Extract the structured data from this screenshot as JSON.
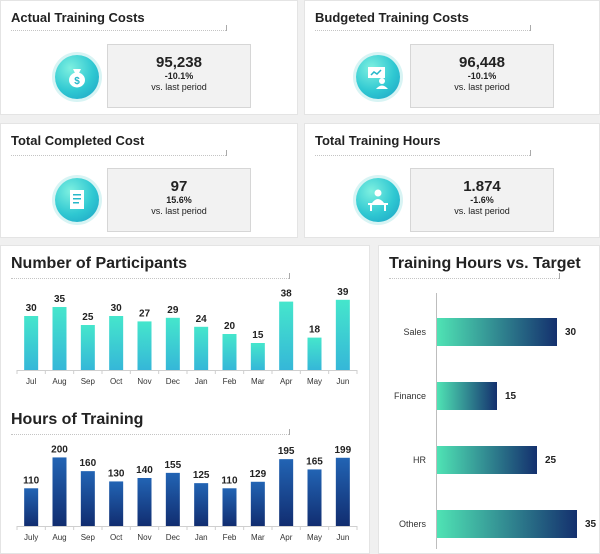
{
  "kpis": [
    {
      "title": "Actual Training Costs",
      "value": "95,238",
      "change": "-10.1%",
      "period": "vs. last period",
      "icon": "money-bag-icon"
    },
    {
      "title": "Budgeted Training Costs",
      "value": "96,448",
      "change": "-10.1%",
      "period": "vs. last period",
      "icon": "presentation-icon"
    },
    {
      "title": "Total Completed Cost",
      "value": "97",
      "change": "15.6%",
      "period": "vs. last period",
      "icon": "document-icon"
    },
    {
      "title": "Total Training Hours",
      "value": "1.874",
      "change": "-1.6%",
      "period": "vs. last period",
      "icon": "trainee-desk-icon"
    }
  ],
  "colors": {
    "accent_teal": "#3fd8c6",
    "accent_navy": "#1b3f86",
    "background": "#f0f0f0"
  },
  "chart_data": [
    {
      "id": "participants",
      "type": "bar",
      "title": "Number of Participants",
      "categories": [
        "Jul",
        "Aug",
        "Sep",
        "Oct",
        "Nov",
        "Dec",
        "Jan",
        "Feb",
        "Mar",
        "Apr",
        "May",
        "Jun"
      ],
      "values": [
        30,
        35,
        25,
        30,
        27,
        29,
        24,
        20,
        15,
        38,
        18,
        39
      ],
      "ylim": [
        0,
        40
      ]
    },
    {
      "id": "hours",
      "type": "bar",
      "title": "Hours of Training",
      "categories": [
        "July",
        "Aug",
        "Sep",
        "Oct",
        "Nov",
        "Dec",
        "Jan",
        "Feb",
        "Mar",
        "Apr",
        "May",
        "Jun"
      ],
      "values": [
        110,
        200,
        160,
        130,
        140,
        155,
        125,
        110,
        129,
        195,
        165,
        199
      ],
      "ylim": [
        0,
        210
      ]
    },
    {
      "id": "target",
      "type": "bar",
      "orientation": "horizontal",
      "title": "Training Hours vs. Target",
      "categories": [
        "Sales",
        "Finance",
        "HR",
        "Others"
      ],
      "values": [
        30,
        15,
        25,
        35
      ],
      "xlim": [
        0,
        35
      ]
    }
  ]
}
